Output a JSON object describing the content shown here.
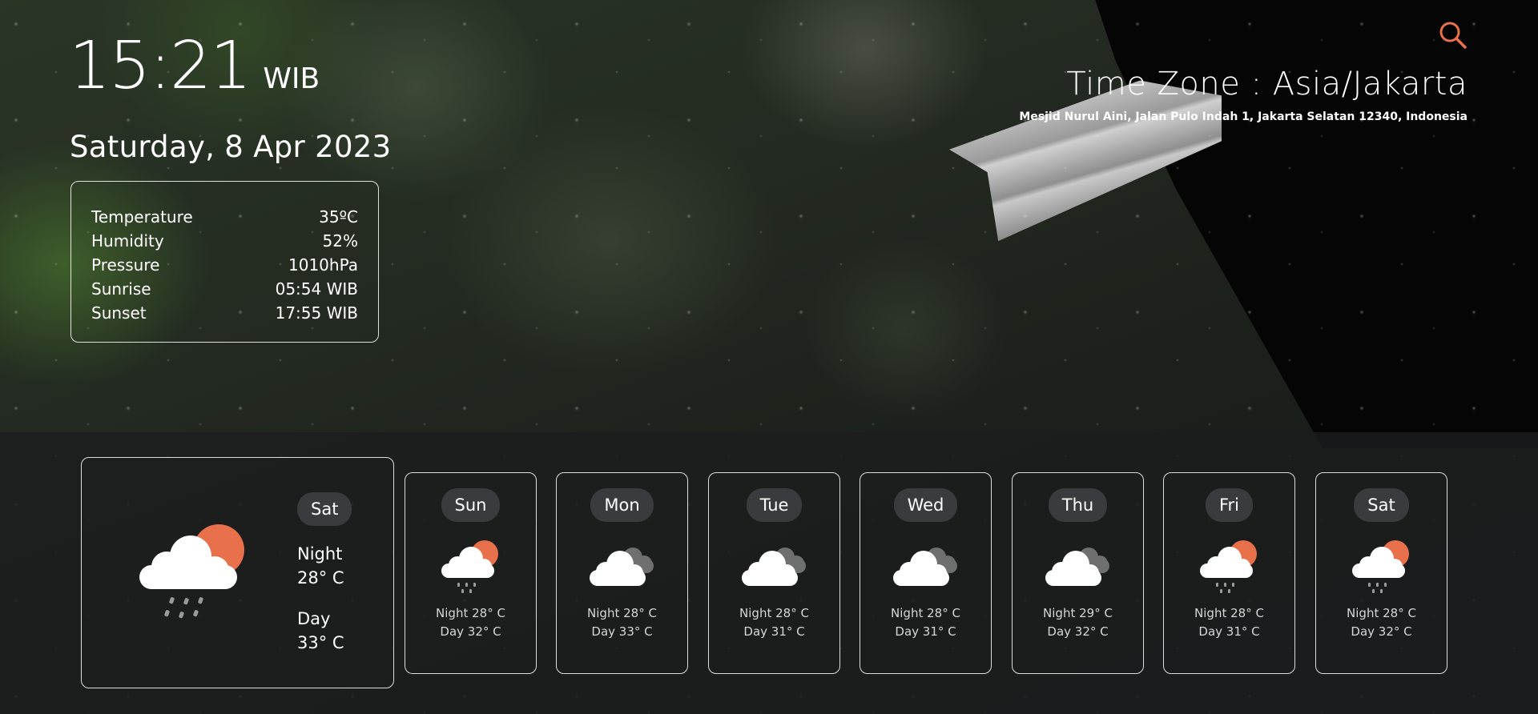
{
  "clock": {
    "time": "15:21",
    "tz": "WIB"
  },
  "date": "Saturday, 8 Apr 2023",
  "stats": [
    {
      "label": "Temperature",
      "value": "35ºC"
    },
    {
      "label": "Humidity",
      "value": "52%"
    },
    {
      "label": "Pressure",
      "value": "1010hPa"
    },
    {
      "label": "Sunrise",
      "value": "05:54 WIB"
    },
    {
      "label": "Sunset",
      "value": "17:55 WIB"
    }
  ],
  "header": {
    "timezone": "Time Zone : Asia/Jakarta",
    "address": "Mesjid Nurul Aini, Jalan Pulo Indah 1, Jakarta Selatan 12340, Indonesia"
  },
  "colors": {
    "accent": "#e8704a",
    "pill_bg": "#3a3b3f"
  },
  "today": {
    "day": "Sat",
    "icon": "sun-cloud-rain-icon",
    "night_label": "Night",
    "night_temp": "28° C",
    "day_label": "Day",
    "day_temp": "33° C"
  },
  "forecast": [
    {
      "day": "Sun",
      "icon": "sun-cloud-rain-icon",
      "night": "Night 28° C",
      "daytemp": "Day 32° C"
    },
    {
      "day": "Mon",
      "icon": "clouds-icon",
      "night": "Night 28° C",
      "daytemp": "Day 33° C"
    },
    {
      "day": "Tue",
      "icon": "clouds-icon",
      "night": "Night 28° C",
      "daytemp": "Day 31° C"
    },
    {
      "day": "Wed",
      "icon": "clouds-icon",
      "night": "Night 28° C",
      "daytemp": "Day 31° C"
    },
    {
      "day": "Thu",
      "icon": "clouds-icon",
      "night": "Night 29° C",
      "daytemp": "Day 32° C"
    },
    {
      "day": "Fri",
      "icon": "sun-cloud-rain-icon",
      "night": "Night 28° C",
      "daytemp": "Day 31° C"
    },
    {
      "day": "Sat",
      "icon": "sun-cloud-rain-icon",
      "night": "Night 28° C",
      "daytemp": "Day 32° C"
    }
  ]
}
